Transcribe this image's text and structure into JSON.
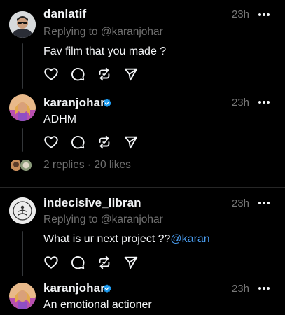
{
  "posts": [
    {
      "username": "danlatif",
      "time": "23h",
      "replying": "Replying to @karanjohar",
      "text": "Fav film that you made ?"
    },
    {
      "username": "karanjohar",
      "verified": true,
      "time": "23h",
      "text": "ADHM",
      "replies_summary": "2 replies · 20 likes"
    },
    {
      "username": "indecisive_libran",
      "time": "23h",
      "replying": "Replying to @karanjohar",
      "text_prefix": "What is ur next project ??",
      "text_mention": "@karan"
    },
    {
      "username": "karanjohar",
      "verified": true,
      "time": "23h",
      "text": "An emotional actioner"
    }
  ],
  "icons": {
    "like": "heart-icon",
    "comment": "comment-icon",
    "repost": "repost-icon",
    "share": "send-icon",
    "more": "more-icon",
    "verified": "verified-badge-icon"
  },
  "colors": {
    "background": "#000000",
    "text": "#f3f5f7",
    "secondary": "#6f6f6f",
    "mention": "#4a9df0",
    "verified": "#1d9bf0"
  }
}
